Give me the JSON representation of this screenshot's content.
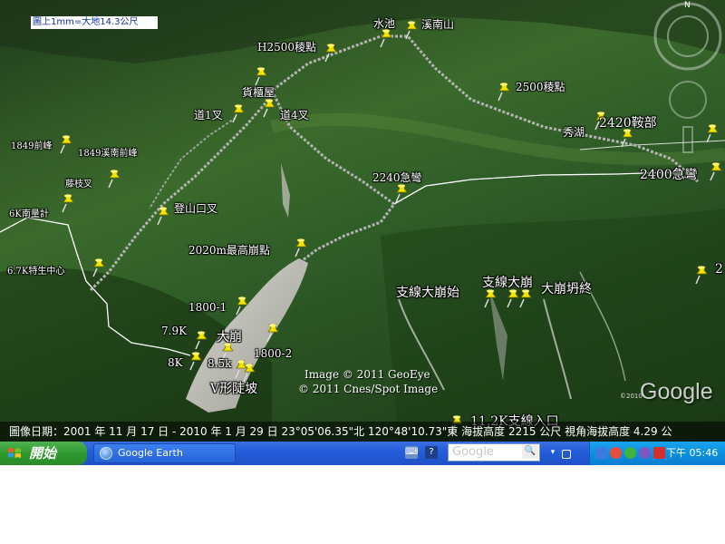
{
  "map": {
    "scale_text": "圖上1mm=大地14.3公尺",
    "labels": {
      "l1849_peak": "1849前峰",
      "l1849_south": "1849溪南前峰",
      "tengzhi": "藤枝叉",
      "south6k": "6K南量計",
      "center67k": "6.7K特生中心",
      "h2500": "H2500稜點",
      "shuichi": "水池",
      "xinan": "溪南山",
      "huoguiwu": "貨櫃屋",
      "dao1": "道1叉",
      "dao4": "道4叉",
      "dengshan": "登山口叉",
      "p2020": "2020m最高崩點",
      "p2240": "2240急彎",
      "p2500": "2500稜點",
      "p2420": "2420鞍部",
      "xiuhu": "秀湖",
      "p2400": "2400急彎",
      "r2": "2",
      "branch_start": "支線大崩始",
      "branch": "支線大崩",
      "branch_end": "大崩坍終",
      "p1800_1": "1800-1",
      "p79k": "7.9K",
      "dabeng": "大崩",
      "p1800_2": "1800-2",
      "p8k": "8K",
      "p85k": "8.5k",
      "vslope": "V形陡坡",
      "entrance": "11.2K支線入口"
    },
    "credit1": "Image © 2011 GeoEye",
    "credit2": "© 2011 Cnes/Spot Image",
    "logo": "Google",
    "tiny": "©2010",
    "status": "圖像日期：2001 年 11 月 17 日 - 2010 年 1 月 29 日 23°05'06.35\"北  120°48'10.73\"東     海拔高度 2215 公尺 視角海拔高度    4.29 公",
    "nav_north": "N"
  },
  "taskbar": {
    "start_label": "開始",
    "window_label": "Google Earth",
    "search_text": "Google",
    "clock": "下午 05:46"
  },
  "colors": {
    "pin": "#f2e600",
    "taskbar": "#245edb",
    "start": "#2f9a2f",
    "tray": "#0d8fdf"
  }
}
